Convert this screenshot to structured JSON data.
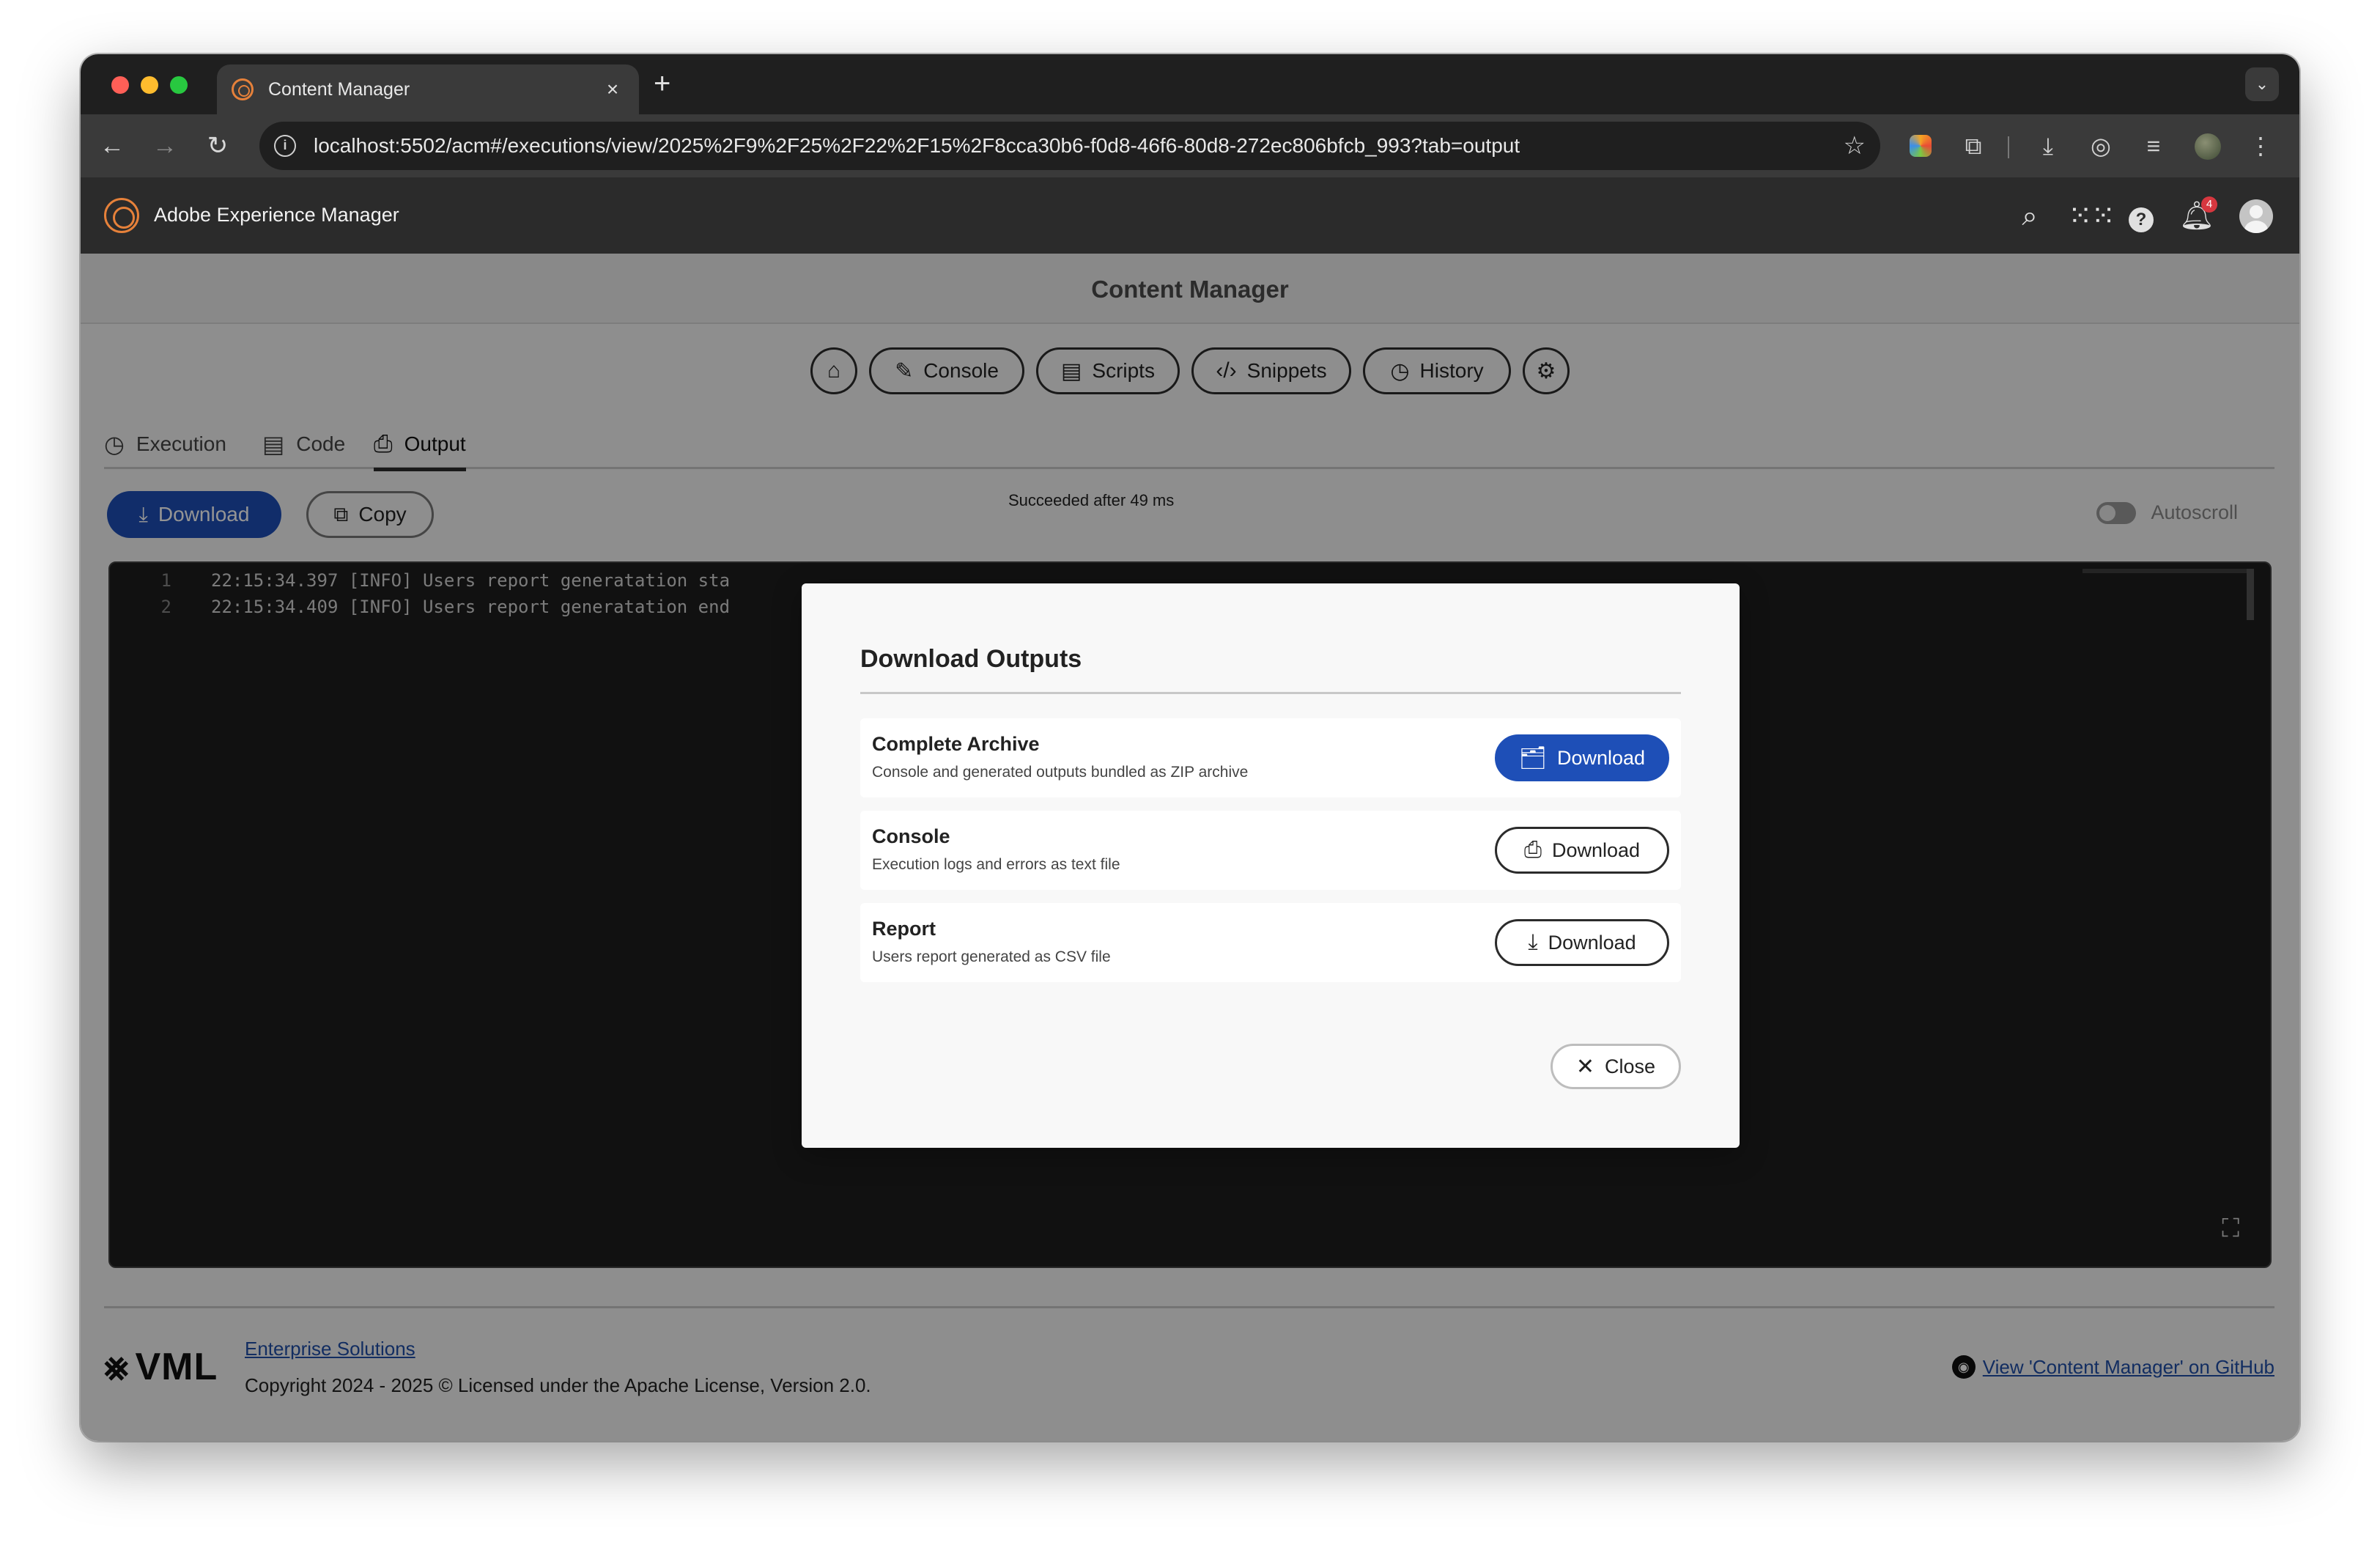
{
  "browser": {
    "tab_title": "Content Manager",
    "tab_close": "×",
    "new_tab": "+",
    "tab_dropdown": "⌄",
    "url": "localhost:5502/acm#/executions/view/2025%2F9%2F25%2F22%2F15%2F8cca30b6-f0d8-46f6-80d8-272ec806bfcb_993?tab=output",
    "nav_back": "←",
    "nav_forward": "→",
    "nav_reload": "↻",
    "info_icon": "i",
    "bookmark_icon": "☆"
  },
  "aem": {
    "title": "Adobe Experience Manager",
    "notification_count": "4"
  },
  "page": {
    "title": "Content Manager"
  },
  "nav": {
    "console": "Console",
    "scripts": "Scripts",
    "snippets": "Snippets",
    "history": "History"
  },
  "subtabs": {
    "execution": "Execution",
    "code": "Code",
    "output": "Output"
  },
  "actions": {
    "download": "Download",
    "copy": "Copy",
    "status": "Succeeded after 49 ms",
    "autoscroll": "Autoscroll"
  },
  "editor": {
    "lines": [
      {
        "num": "1",
        "text": "22:15:34.397 [INFO] Users report generatation sta"
      },
      {
        "num": "2",
        "text": "22:15:34.409 [INFO] Users report generatation end"
      }
    ]
  },
  "footer": {
    "logo": "VML",
    "enterprise_link": "Enterprise Solutions",
    "copyright": "Copyright 2024 - 2025 © Licensed under the Apache License, Version 2.0.",
    "github_link": "View 'Content Manager' on GitHub"
  },
  "modal": {
    "title": "Download Outputs",
    "items": [
      {
        "title": "Complete Archive",
        "description": "Console and generated outputs bundled as ZIP archive",
        "button": "Download",
        "icon": "archive-icon"
      },
      {
        "title": "Console",
        "description": "Execution logs and errors as text file",
        "button": "Download",
        "icon": "printer-icon"
      },
      {
        "title": "Report",
        "description": "Users report generated as CSV file",
        "button": "Download",
        "icon": "download-icon"
      }
    ],
    "close": "Close"
  },
  "colors": {
    "accent": "#1e4fb7",
    "header": "#2b2b2b",
    "badge": "#d7373f"
  }
}
